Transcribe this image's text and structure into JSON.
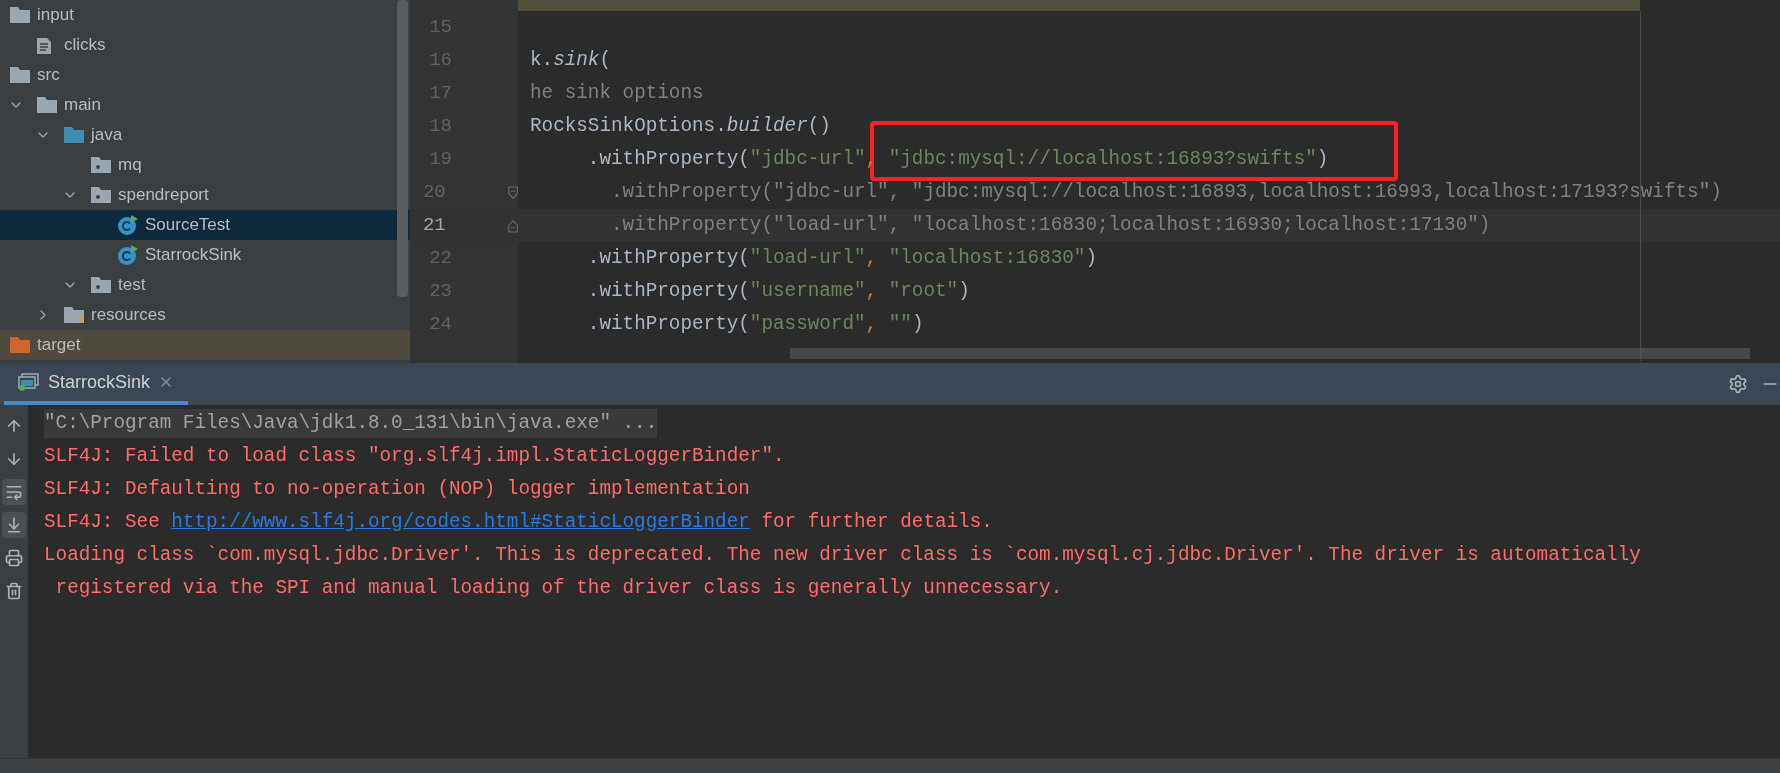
{
  "project_tree": {
    "items": [
      {
        "label": "input",
        "kind": "folder",
        "selected": false,
        "children": [
          {
            "label": "clicks",
            "kind": "file",
            "selected": false
          }
        ]
      },
      {
        "label": "src",
        "kind": "folder",
        "selected": false,
        "children": [
          {
            "label": "main",
            "kind": "folder",
            "expanded": true,
            "selected": false,
            "children": [
              {
                "label": "java",
                "kind": "source-folder",
                "expanded": true,
                "selected": false,
                "children": [
                  {
                    "label": "mq",
                    "kind": "package",
                    "selected": false
                  },
                  {
                    "label": "spendreport",
                    "kind": "package",
                    "expanded": true,
                    "selected": false,
                    "children": [
                      {
                        "label": "SourceTest",
                        "kind": "class",
                        "selected": true
                      },
                      {
                        "label": "StarrockSink",
                        "kind": "class",
                        "selected": false
                      }
                    ]
                  },
                  {
                    "label": "test",
                    "kind": "package",
                    "expanded": true,
                    "selected": false
                  }
                ]
              },
              {
                "label": "resources",
                "kind": "resources",
                "expanded": false,
                "selected": false
              }
            ]
          }
        ]
      },
      {
        "label": "target",
        "kind": "excluded",
        "selected": false
      }
    ]
  },
  "editor": {
    "lines": [
      {
        "number": "15",
        "current": false,
        "kind": "code"
      },
      {
        "number": "16",
        "current": false,
        "tokens": [
          {
            "kind": "plain",
            "text": "k."
          },
          {
            "kind": "method",
            "text": "sink"
          },
          {
            "kind": "plain",
            "text": "("
          }
        ]
      },
      {
        "number": "17",
        "current": false,
        "tokens": [
          {
            "kind": "comment",
            "text": "he sink options"
          }
        ]
      },
      {
        "number": "18",
        "current": false,
        "tokens": [
          {
            "kind": "plain",
            "text": "RocksSinkOptions."
          },
          {
            "kind": "method",
            "text": "builder"
          },
          {
            "kind": "plain",
            "text": "()"
          }
        ]
      },
      {
        "number": "19",
        "current": false,
        "tokens": [
          {
            "kind": "plain",
            "text": "     .withProperty("
          },
          {
            "kind": "string",
            "text": "\"jdbc-url\""
          },
          {
            "kind": "punct",
            "text": ", "
          },
          {
            "kind": "string",
            "text": "\"jdbc:mysql://localhost:16893?swifts\""
          },
          {
            "kind": "plain",
            "text": ")"
          }
        ]
      },
      {
        "number": "20",
        "current": false,
        "kind": "fold-start",
        "tokens": [
          {
            "kind": "comment",
            "text": "       .withProperty(\"jdbc-url\", \"jdbc:mysql://localhost:16893,localhost:16993,localhost:17193?swifts\")"
          }
        ]
      },
      {
        "number": "21",
        "current": true,
        "kind": "fold-end",
        "tokens": [
          {
            "kind": "comment",
            "text": "       .withProperty(\"load-url\", \"localhost:16830;localhost:16930;localhost:17130\")"
          }
        ]
      },
      {
        "number": "22",
        "current": false,
        "tokens": [
          {
            "kind": "plain",
            "text": "     .withProperty("
          },
          {
            "kind": "string",
            "text": "\"load-url\""
          },
          {
            "kind": "punct",
            "text": ", "
          },
          {
            "kind": "string",
            "text": "\"localhost:16830\""
          },
          {
            "kind": "plain",
            "text": ")"
          }
        ]
      },
      {
        "number": "23",
        "current": false,
        "tokens": [
          {
            "kind": "plain",
            "text": "     .withProperty("
          },
          {
            "kind": "string",
            "text": "\"username\""
          },
          {
            "kind": "punct",
            "text": ", "
          },
          {
            "kind": "string",
            "text": "\"root\""
          },
          {
            "kind": "plain",
            "text": ")"
          }
        ]
      },
      {
        "number": "24",
        "current": false,
        "tokens": [
          {
            "kind": "plain",
            "text": "     .withProperty("
          },
          {
            "kind": "string",
            "text": "\"password\""
          },
          {
            "kind": "punct",
            "text": ", "
          },
          {
            "kind": "string",
            "text": "\"\""
          },
          {
            "kind": "plain",
            "text": ")"
          }
        ]
      }
    ]
  },
  "run_panel": {
    "tabs": [
      {
        "label": "StarrockSink",
        "selected": true
      }
    ],
    "toolbar": [
      {
        "kind": "up",
        "selected": false
      },
      {
        "kind": "down",
        "selected": false
      },
      {
        "kind": "wrap",
        "selected": true
      },
      {
        "kind": "scroll-end",
        "selected": true
      },
      {
        "kind": "print",
        "selected": false
      },
      {
        "kind": "clear",
        "selected": false
      }
    ],
    "lines": [
      {
        "kind": "command",
        "text": "\"C:\\Program Files\\Java\\jdk1.8.0_131\\bin\\java.exe\" ..."
      },
      {
        "kind": "error",
        "text": "SLF4J: Failed to load class \"org.slf4j.impl.StaticLoggerBinder\"."
      },
      {
        "kind": "error",
        "text": "SLF4J: Defaulting to no-operation (NOP) logger implementation"
      },
      {
        "kind": "error",
        "text": "SLF4J: See ",
        "link": "http://www.slf4j.org/codes.html#StaticLoggerBinder",
        "after": " for further details."
      },
      {
        "kind": "error",
        "text": "Loading class `com.mysql.jdbc.Driver'. This is deprecated. The new driver class is `com.mysql.cj.jdbc.Driver'. The driver is automatically"
      },
      {
        "kind": "error",
        "text": " registered via the SPI and manual loading of the driver class is generally unnecessary."
      }
    ]
  }
}
